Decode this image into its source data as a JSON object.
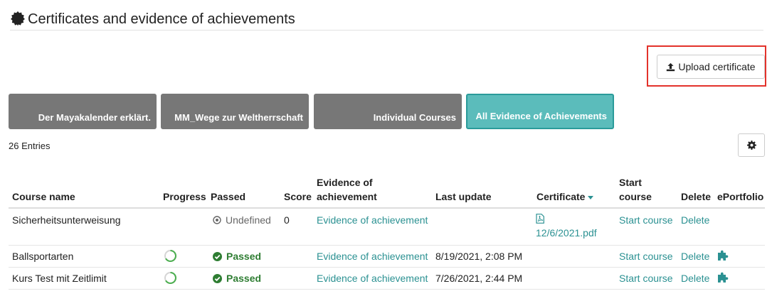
{
  "page": {
    "title": "Certificates and evidence of achievements"
  },
  "toolbar": {
    "upload_label": "Upload certificate"
  },
  "tabs": [
    {
      "label": "Der Mayakalender erklärt."
    },
    {
      "label": "MM_Wege zur Weltherrschaft"
    },
    {
      "label": "Individual Courses"
    },
    {
      "label": "All Evidence of Achievements",
      "active": true
    }
  ],
  "entries_count": "26 Entries",
  "table": {
    "headers": {
      "course_name": "Course name",
      "progress": "Progress",
      "passed": "Passed",
      "score": "Score",
      "evidence_line1": "Evidence of",
      "evidence_line2": "achievement",
      "last_update": "Last update",
      "certificate": "Certificate",
      "start_line1": "Start",
      "start_line2": "course",
      "delete": "Delete",
      "eportfolio": "ePortfolio"
    },
    "rows": [
      {
        "course_name": "Sicherheitsunterweisung",
        "progress": null,
        "passed": "Undefined",
        "score": "0",
        "evidence": "Evidence of achievement",
        "last_update": "",
        "certificate_line1": "",
        "certificate_line2": "12/6/2021.pdf",
        "start": "Start course",
        "delete": "Delete"
      },
      {
        "course_name": "Ballsportarten",
        "progress": 0.6,
        "passed": "Passed",
        "score": "",
        "evidence": "Evidence of achievement",
        "last_update": "8/19/2021, 2:08 PM",
        "start": "Start course",
        "delete": "Delete"
      },
      {
        "course_name": "Kurs Test mit Zeitlimit",
        "progress": 0.6,
        "passed": "Passed",
        "score": "",
        "evidence": "Evidence of achievement",
        "last_update": "7/26/2021, 2:44 PM",
        "start": "Start course",
        "delete": "Delete"
      }
    ]
  },
  "icons": {
    "title": "certificate-badge-icon",
    "upload": "upload-icon",
    "settings": "gear-icon",
    "undefined_status": "dot-circle-icon",
    "passed_status": "check-circle-icon",
    "pdf": "pdf-file-icon",
    "eportfolio": "puzzle-icon"
  },
  "colors": {
    "link": "#2b9192",
    "tab_inactive": "#777777",
    "tab_active": "#5bbcbb",
    "passed": "#2e7d32",
    "highlight": "#e3322b"
  }
}
